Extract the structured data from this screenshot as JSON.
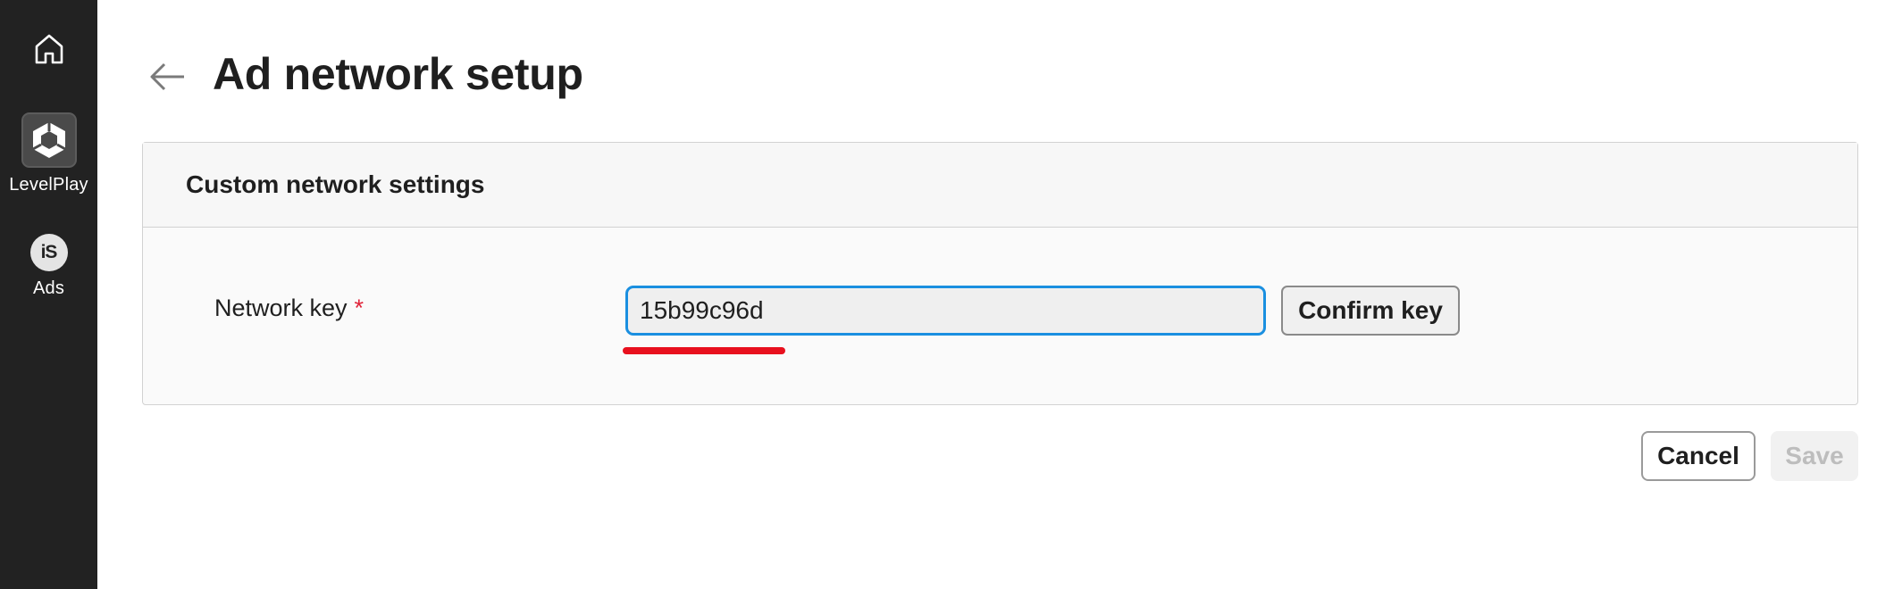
{
  "sidebar": {
    "items": [
      {
        "label": "",
        "icon": "home-icon"
      },
      {
        "label": "LevelPlay",
        "icon": "unity-logo-icon"
      },
      {
        "label": "Ads",
        "icon": "is-logo-icon",
        "icon_text": "iS"
      }
    ]
  },
  "header": {
    "title": "Ad network setup",
    "back_icon": "arrow-left-icon"
  },
  "card": {
    "title": "Custom network settings",
    "field": {
      "label": "Network key",
      "required_mark": "*",
      "value": "15b99c96d"
    },
    "confirm_label": "Confirm key"
  },
  "actions": {
    "cancel_label": "Cancel",
    "save_label": "Save",
    "save_disabled": true
  },
  "colors": {
    "sidebar_bg": "#222222",
    "input_focus_border": "#1a8fe0",
    "required": "#e0243a",
    "annotation_underline": "#e8101e",
    "disabled_text": "#bdbdbd"
  }
}
